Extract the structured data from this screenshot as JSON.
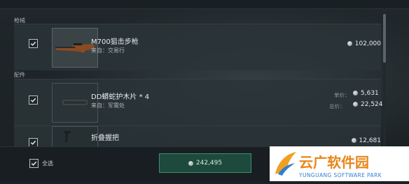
{
  "sections": {
    "guns_label": "枪械",
    "parts_label": "配件"
  },
  "items": [
    {
      "name": "M700狙击步枪",
      "source": "来自：交易行",
      "total": "102,000",
      "checked": true
    },
    {
      "name": "DD蟒蛇护木片 * 4",
      "source": "来自：军需处",
      "unit_label": "单价：",
      "unit_price": "5,631",
      "total_label": "总价：",
      "total": "22,524",
      "checked": true
    },
    {
      "name": "折叠握把",
      "total": "12,681",
      "checked": true
    }
  ],
  "footer": {
    "select_all_label": "全选",
    "grand_total": "242,495"
  },
  "watermark": {
    "text": "云广软件园",
    "subtext": "YUNGUANG SOFTWARE PARK"
  },
  "colors": {
    "accent": "#3e8f73",
    "watermark_orange": "#f0a020"
  }
}
